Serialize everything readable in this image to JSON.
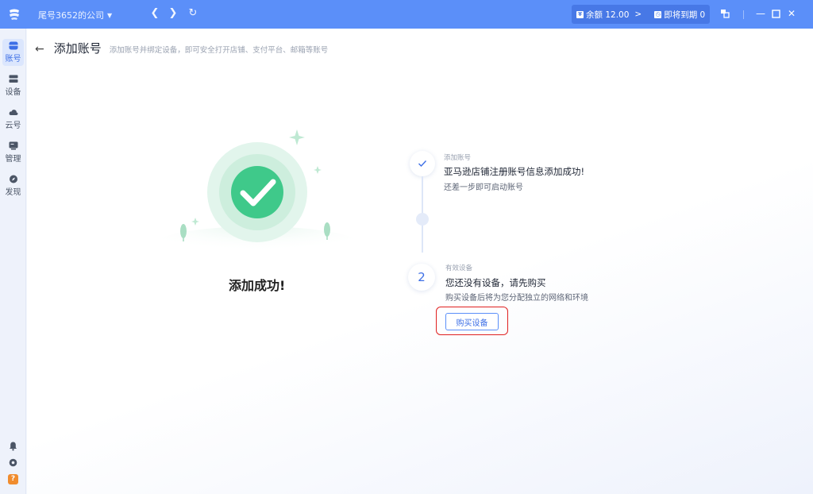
{
  "titlebar": {
    "company": "尾号3652的公司",
    "balance_label": "余额 12.00",
    "balance_arrow": ">",
    "expire_label": "即将到期 0"
  },
  "sidebar": {
    "items": [
      {
        "label": "账号",
        "icon": "account-icon"
      },
      {
        "label": "设备",
        "icon": "device-icon"
      },
      {
        "label": "云号",
        "icon": "cloud-icon"
      },
      {
        "label": "管理",
        "icon": "manage-icon"
      },
      {
        "label": "发现",
        "icon": "discover-icon"
      }
    ],
    "bottom_icons": [
      "bell-icon",
      "gear-icon",
      "help-icon"
    ]
  },
  "header": {
    "title": "添加账号",
    "subtitle": "添加账号并绑定设备，即可安全打开店铺、支付平台、邮箱等账号"
  },
  "hero": {
    "success_text": "添加成功!"
  },
  "steps": [
    {
      "tag": "添加账号",
      "title": "亚马逊店铺注册账号信息添加成功!",
      "desc": "还差一步即可启动账号"
    },
    {
      "number": "2",
      "tag": "有效设备",
      "title": "您还没有设备，请先购买",
      "desc": "购买设备后将为您分配独立的网络和环境",
      "button": "购买设备"
    }
  ],
  "colors": {
    "accent": "#5b8ff9",
    "success": "#3fc98a",
    "highlight": "#e02020"
  }
}
